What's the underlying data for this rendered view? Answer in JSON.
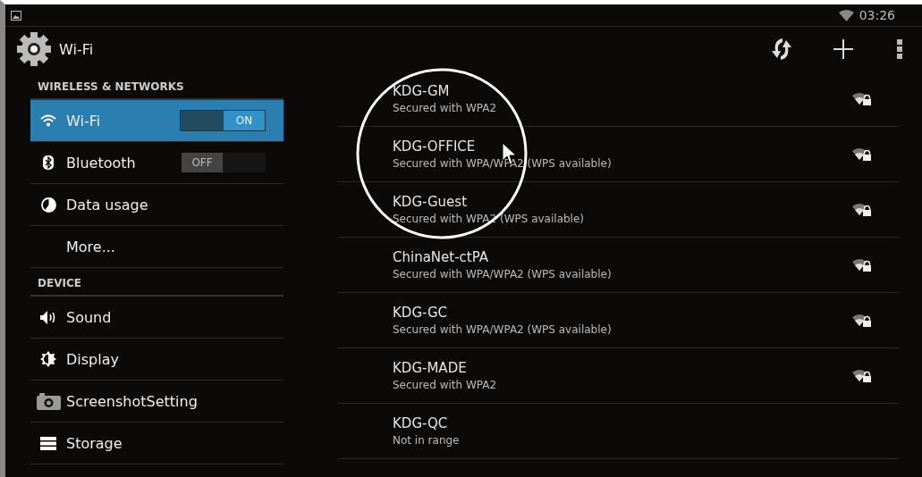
{
  "status_bar": {
    "time": "03:26"
  },
  "action_bar": {
    "title": "Wi-Fi"
  },
  "sidebar": {
    "sections": [
      {
        "header": "WIRELESS & NETWORKS",
        "items": [
          {
            "label": "Wi-Fi",
            "kind": "wifi",
            "selected": true,
            "toggle": {
              "label": "ON",
              "on": true
            }
          },
          {
            "label": "Bluetooth",
            "kind": "bluetooth",
            "selected": false,
            "toggle": {
              "label": "OFF",
              "on": false
            }
          },
          {
            "label": "Data usage",
            "kind": "data",
            "selected": false
          },
          {
            "label": "More...",
            "kind": "plain",
            "selected": false
          }
        ]
      },
      {
        "header": "DEVICE",
        "items": [
          {
            "label": "Sound",
            "kind": "sound",
            "selected": false
          },
          {
            "label": "Display",
            "kind": "display",
            "selected": false
          },
          {
            "label": "ScreenshotSetting",
            "kind": "camera",
            "selected": false
          },
          {
            "label": "Storage",
            "kind": "storage",
            "selected": false
          }
        ]
      }
    ]
  },
  "networks": [
    {
      "name": "KDG-GM",
      "status": "Secured with WPA2",
      "in_range": true
    },
    {
      "name": "KDG-OFFICE",
      "status": "Secured with WPA/WPA2 (WPS available)",
      "in_range": true
    },
    {
      "name": "KDG-Guest",
      "status": "Secured with WPA2 (WPS available)",
      "in_range": true
    },
    {
      "name": "ChinaNet-ctPA",
      "status": "Secured with WPA/WPA2 (WPS available)",
      "in_range": true
    },
    {
      "name": "KDG-GC",
      "status": "Secured with WPA/WPA2 (WPS available)",
      "in_range": true
    },
    {
      "name": "KDG-MADE",
      "status": "Secured with WPA2",
      "in_range": true
    },
    {
      "name": "KDG-QC",
      "status": "Not in range",
      "in_range": false
    }
  ]
}
